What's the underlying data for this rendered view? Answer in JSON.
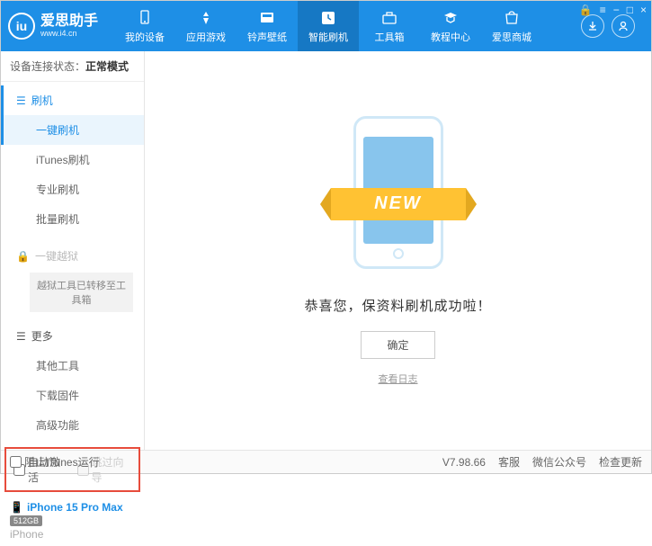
{
  "header": {
    "logo_title": "爱思助手",
    "logo_url": "www.i4.cn",
    "nav": [
      {
        "label": "我的设备"
      },
      {
        "label": "应用游戏"
      },
      {
        "label": "铃声壁纸"
      },
      {
        "label": "智能刷机"
      },
      {
        "label": "工具箱"
      },
      {
        "label": "教程中心"
      },
      {
        "label": "爱思商城"
      }
    ]
  },
  "sidebar": {
    "status_label": "设备连接状态：",
    "status_value": "正常模式",
    "flash_header": "刷机",
    "flash_items": [
      "一键刷机",
      "iTunes刷机",
      "专业刷机",
      "批量刷机"
    ],
    "jailbreak_header": "一键越狱",
    "jailbreak_note": "越狱工具已转移至工具箱",
    "more_header": "更多",
    "more_items": [
      "其他工具",
      "下载固件",
      "高级功能"
    ],
    "auto_activate": "自动激活",
    "skip_guide": "跳过向导",
    "device_name": "iPhone 15 Pro Max",
    "device_storage": "512GB",
    "device_type": "iPhone"
  },
  "main": {
    "ribbon": "NEW",
    "success": "恭喜您，保资料刷机成功啦！",
    "ok": "确定",
    "log": "查看日志"
  },
  "footer": {
    "block_itunes": "阻止iTunes运行",
    "version": "V7.98.66",
    "links": [
      "客服",
      "微信公众号",
      "检查更新"
    ]
  }
}
